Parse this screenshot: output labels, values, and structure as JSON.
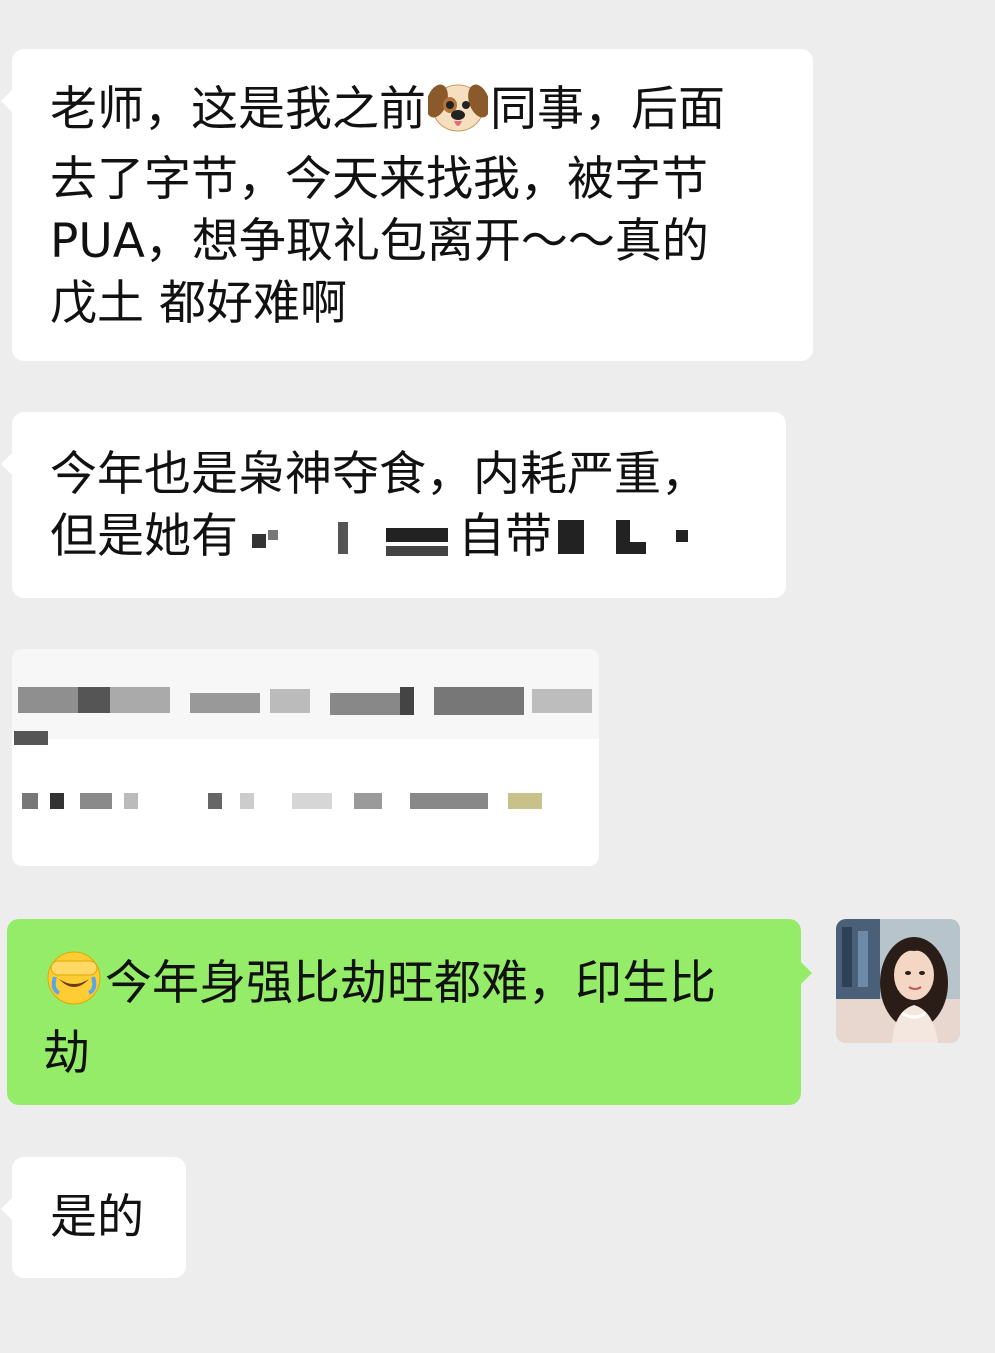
{
  "messages": [
    {
      "side": "left",
      "lines": [
        "老师，这是我之前",
        "同事，后面",
        "去了字节，今天来找我，被字节",
        "PUA，想争取礼包离开～～真的",
        "戊土 都好难啊"
      ],
      "emoji": "dog-face"
    },
    {
      "side": "left",
      "line1": "今年也是枭神夺食，内耗严重，",
      "line2_start": "但是她有",
      "line2_mid": "自带"
    },
    {
      "side": "left",
      "type": "forwarded-card-redacted"
    },
    {
      "side": "right",
      "emoji": "face-palm-laughing",
      "line1": "今年身强比劫旺都难，印生比",
      "line2": "劫"
    },
    {
      "side": "left",
      "text": "是的"
    }
  ],
  "colors": {
    "background": "#ededed",
    "incoming_bubble": "#ffffff",
    "outgoing_bubble": "#95ec69"
  }
}
